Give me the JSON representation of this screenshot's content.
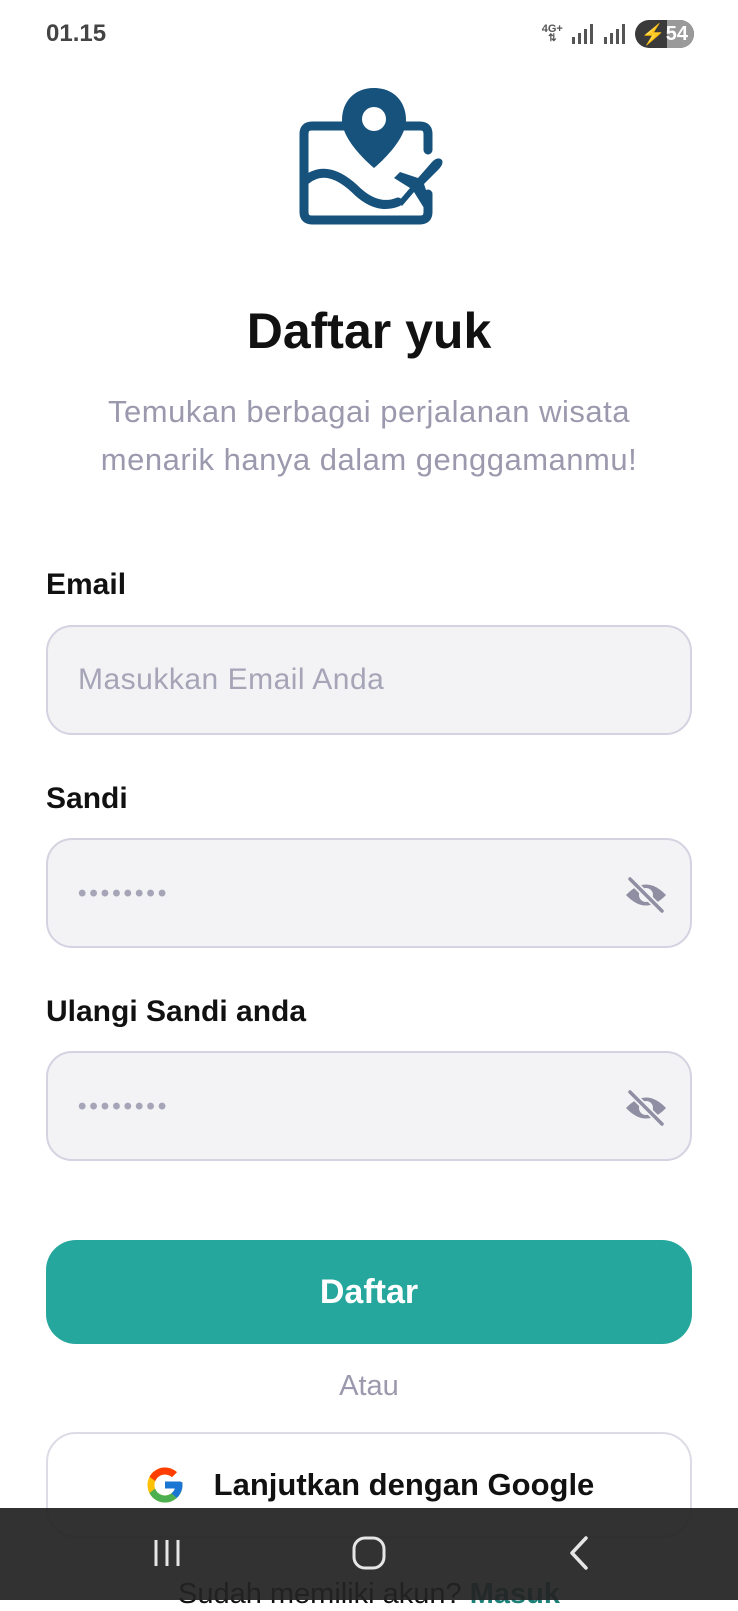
{
  "status_bar": {
    "time": "01.15",
    "network": "4G+",
    "battery_level": "54"
  },
  "header": {
    "logo_icon": "map-location-plane-icon",
    "title": "Daftar yuk",
    "subtitle_line1": "Temukan berbagai perjalanan wisata",
    "subtitle_line2": "menarik hanya dalam genggamanmu!"
  },
  "form": {
    "email": {
      "label": "Email",
      "placeholder": "Masukkan Email Anda"
    },
    "password": {
      "label": "Sandi",
      "masked_value": "••••••••"
    },
    "confirm_password": {
      "label": "Ulangi Sandi anda",
      "masked_value": "••••••••"
    },
    "submit_label": "Daftar"
  },
  "divider_text": "Atau",
  "google_button": {
    "label": "Lanjutkan dengan Google"
  },
  "footer": {
    "prompt": "Sudah memiliki akun?",
    "link": "Masuk"
  },
  "colors": {
    "primary": "#26a79d",
    "logo": "#16527c",
    "muted_text": "#9b99ad",
    "field_bg": "#f3f3f5",
    "field_border": "#d3d3e2"
  },
  "nav_icons": [
    "recent-apps-icon",
    "home-icon",
    "back-icon"
  ]
}
